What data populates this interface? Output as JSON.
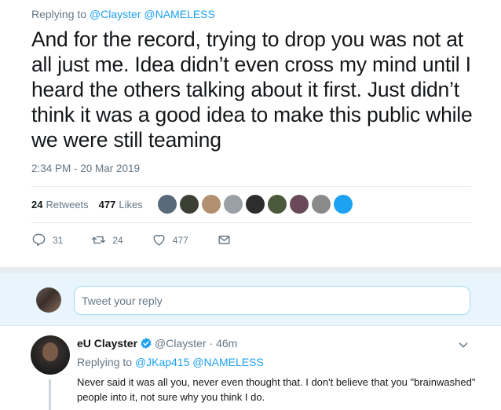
{
  "main_tweet": {
    "replying_prefix": "Replying to",
    "replying_handles": "@Clayster @NAMELESS",
    "text": "And for the record, trying to drop you was not at all just me. Idea didn’t even cross my mind until I heard the others talking about it first. Just didn’t think it was a good idea to make this public while we were still teaming",
    "timestamp": "2:34 PM - 20 Mar 2019",
    "retweets_count": "24",
    "retweets_label": "Retweets",
    "likes_count": "477",
    "likes_label": "Likes",
    "liker_avatar_colors": [
      "#5a6a7a",
      "#3c3f33",
      "#b09070",
      "#9aa0a6",
      "#2d2d2d",
      "#4a5a3a",
      "#6a4a5a",
      "#8a8a8a",
      "#1da1f2"
    ],
    "actions": {
      "reply_count": "31",
      "retweet_count": "24",
      "like_count": "477"
    }
  },
  "reply_box": {
    "placeholder": "Tweet your reply"
  },
  "reply_tweet": {
    "name": "eU Clayster",
    "handle": "@Clayster",
    "time": "46m",
    "replying_prefix": "Replying to",
    "replying_handles": "@JKap415 @NAMELESS",
    "text": "Never said it was all you, never even thought that. I don't believe that you \"brainwashed\" people into it, not sure why you think I do."
  },
  "colors": {
    "accent": "#1da1f2",
    "muted": "#657786",
    "reply_bg": "#e8f5fd"
  }
}
